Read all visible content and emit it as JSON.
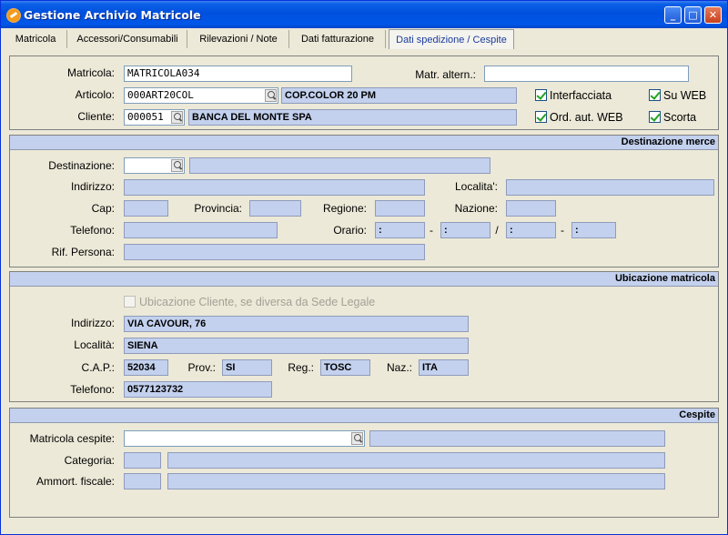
{
  "window": {
    "title": "Gestione Archivio Matricole"
  },
  "tabs": [
    "Matricola",
    "Accessori/Consumabili",
    "Rilevazioni / Note",
    "Dati fatturazione",
    "Dati spedizione / Cespite"
  ],
  "header": {
    "matricola_label": "Matricola:",
    "matricola_value": "MATRICOLA034",
    "matr_altern_label": "Matr. altern.:",
    "matr_altern_value": "",
    "articolo_label": "Articolo:",
    "articolo_code": "000ART20COL",
    "articolo_desc": "COP.COLOR 20 PM",
    "cliente_label": "Cliente:",
    "cliente_code": "000051",
    "cliente_desc": "BANCA DEL MONTE SPA",
    "interfacciata_label": "Interfacciata",
    "su_web_label": "Su WEB",
    "ord_aut_web_label": "Ord. aut. WEB",
    "scorta_label": "Scorta"
  },
  "destinazione": {
    "title": "Destinazione merce",
    "destinazione_label": "Destinazione:",
    "indirizzo_label": "Indirizzo:",
    "localita_label": "Localita':",
    "cap_label": "Cap:",
    "provincia_label": "Provincia:",
    "regione_label": "Regione:",
    "nazione_label": "Nazione:",
    "telefono_label": "Telefono:",
    "orario_label": "Orario:",
    "orario_1": ":",
    "orario_2": ":",
    "orario_3": ":",
    "orario_4": ":",
    "dash": "-",
    "slash": "/",
    "rif_persona_label": "Rif. Persona:"
  },
  "ubicazione": {
    "title": "Ubicazione matricola",
    "checkbox_label": "Ubicazione Cliente, se diversa da Sede Legale",
    "indirizzo_label": "Indirizzo:",
    "indirizzo_value": "VIA CAVOUR, 76",
    "localita_label": "Località:",
    "localita_value": "SIENA",
    "cap_label": "C.A.P.:",
    "cap_value": "52034",
    "prov_label": "Prov.:",
    "prov_value": "SI",
    "reg_label": "Reg.:",
    "reg_value": "TOSC",
    "naz_label": "Naz.:",
    "naz_value": "ITA",
    "telefono_label": "Telefono:",
    "telefono_value": "0577123732"
  },
  "cespite": {
    "title": "Cespite",
    "matricola_cespite_label": "Matricola cespite:",
    "categoria_label": "Categoria:",
    "ammort_label": "Ammort. fiscale:"
  },
  "colors": {
    "titlebar": "#0050DE",
    "field_blue": "#C3D1EE",
    "check_green": "#21A121"
  },
  "icons": {
    "app": "app-icon",
    "lookup": "magnifier-icon"
  }
}
